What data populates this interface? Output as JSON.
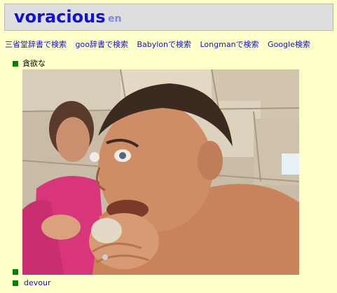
{
  "header": {
    "word": "voracious",
    "lang": "en"
  },
  "search_links": [
    {
      "label": "三省堂辞書で検索"
    },
    {
      "label": "goo辞書で検索"
    },
    {
      "label": "Babylonで検索"
    },
    {
      "label": "Longmanで検索"
    },
    {
      "label": "Google検索"
    }
  ],
  "definitions": [
    {
      "text": "貪欲な"
    },
    {
      "text": ""
    },
    {
      "text": "devour"
    }
  ],
  "colors": {
    "background": "#ffffcc",
    "header_bg": "#dedede",
    "word": "#1010dd",
    "lang": "#8585e6",
    "link": "#1010cc",
    "bullet": "#008000"
  }
}
